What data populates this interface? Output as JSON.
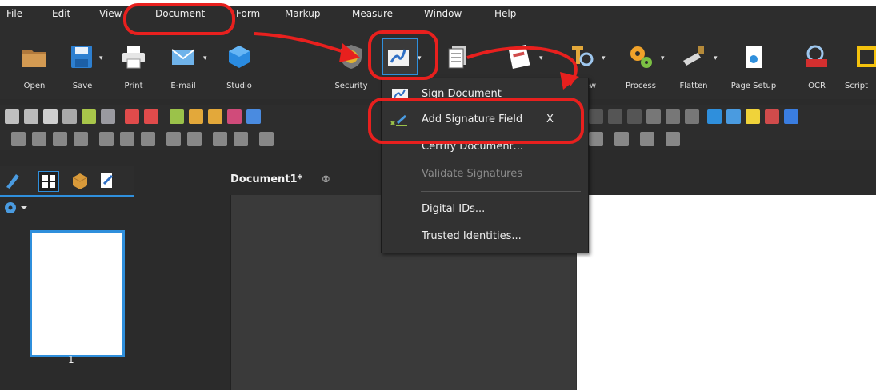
{
  "menu": {
    "items": [
      "File",
      "Edit",
      "View",
      "Document",
      "Form",
      "Markup",
      "Measure",
      "Window",
      "Help"
    ]
  },
  "ribbon": {
    "buttons": [
      "Open",
      "Save",
      "Print",
      "E-mail",
      "Studio",
      "Security",
      "iew",
      "Process",
      "Flatten",
      "Page Setup",
      "OCR",
      "Script"
    ]
  },
  "signature_menu": {
    "items": [
      {
        "label": "Sign Document",
        "shortcut": "",
        "enabled": true
      },
      {
        "label": "Add Signature Field",
        "shortcut": "X",
        "enabled": true
      },
      {
        "label": "Certify Document...",
        "shortcut": "",
        "enabled": true
      },
      {
        "label": "Validate Signatures",
        "shortcut": "",
        "enabled": false
      },
      {
        "label": "Digital IDs...",
        "shortcut": "",
        "enabled": true
      },
      {
        "label": "Trusted Identities...",
        "shortcut": "",
        "enabled": true
      }
    ]
  },
  "document_tab": {
    "title": "Document1*",
    "close_glyph": "⊗"
  },
  "thumbnails": {
    "pages": [
      "1"
    ]
  },
  "colors": {
    "annotation_red": "#e8201e",
    "accent_blue": "#2f8fdc",
    "panel_dark": "#2d2d2d"
  }
}
